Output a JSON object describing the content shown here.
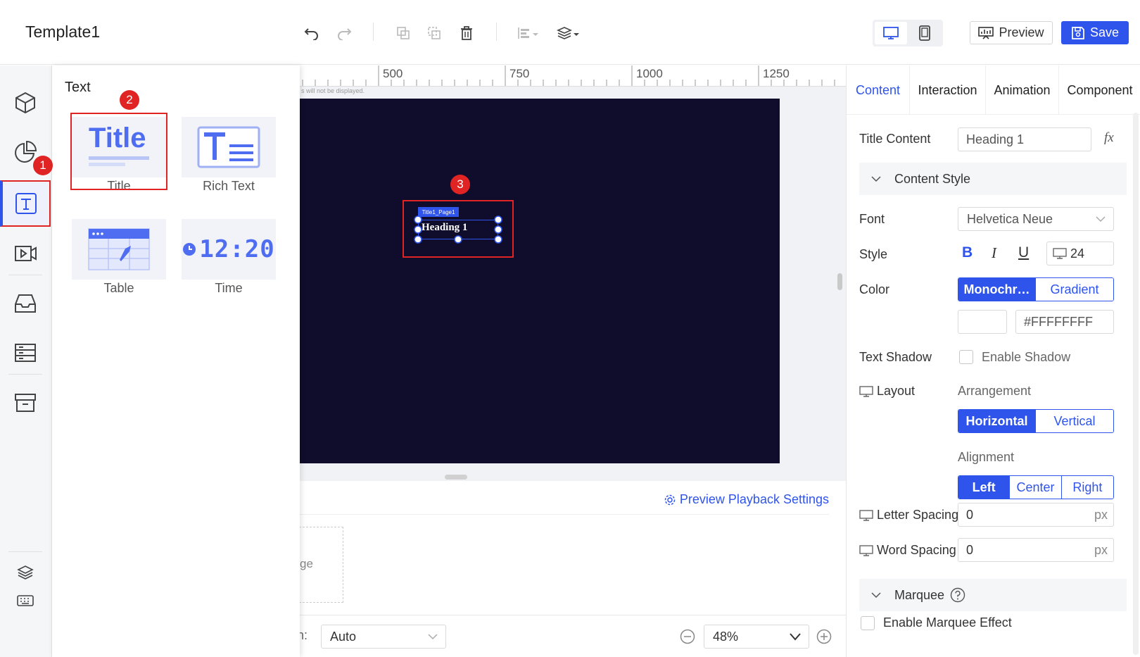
{
  "app": {
    "title": "Template1"
  },
  "toolbar": {
    "preview_label": "Preview",
    "save_label": "Save"
  },
  "text_panel": {
    "title": "Text",
    "items": [
      {
        "label": "Title",
        "thumb": "Title"
      },
      {
        "label": "Rich Text"
      },
      {
        "label": "Table"
      },
      {
        "label": "Time",
        "thumb": "12:20"
      }
    ]
  },
  "ruler": {
    "marks": [
      "500",
      "750",
      "1000",
      "1250"
    ],
    "hint": "s will not be displayed."
  },
  "stage": {
    "element_tag": "Title1_Page1",
    "element_text": "Heading 1"
  },
  "bottom": {
    "playback_settings": "Preview Playback Settings",
    "partial_text": "ge"
  },
  "footer": {
    "partial_label": "n:",
    "mode_value": "Auto",
    "zoom_value": "48%"
  },
  "right_panel": {
    "tabs": [
      "Content",
      "Interaction",
      "Animation",
      "Component"
    ],
    "active_tab": "Content",
    "title_content_label": "Title Content",
    "title_content_value": "Heading 1",
    "fx_label": "fx",
    "content_style_label": "Content Style",
    "font_label": "Font",
    "font_value": "Helvetica Neue",
    "style_label": "Style",
    "bold": "B",
    "italic": "I",
    "underline": "U",
    "font_size": "24",
    "color_label": "Color",
    "color_modes": [
      "Monochr…",
      "Gradient"
    ],
    "color_hex": "#FFFFFFFF",
    "text_shadow_label": "Text Shadow",
    "enable_shadow": "Enable Shadow",
    "layout_label": "Layout",
    "arrangement_label": "Arrangement",
    "arrangement_options": [
      "Horizontal",
      "Vertical"
    ],
    "alignment_label": "Alignment",
    "alignment_options": [
      "Left",
      "Center",
      "Right"
    ],
    "letter_spacing_label": "Letter Spacing",
    "letter_spacing_value": "0",
    "word_spacing_label": "Word Spacing",
    "word_spacing_value": "0",
    "unit_px": "px",
    "marquee_label": "Marquee",
    "enable_marquee": "Enable Marquee Effect"
  },
  "annotations": [
    "1",
    "2",
    "3"
  ],
  "colors": {
    "accent": "#2f54eb",
    "stage_bg": "#0f0d2b",
    "annotation_red": "#e02424"
  }
}
